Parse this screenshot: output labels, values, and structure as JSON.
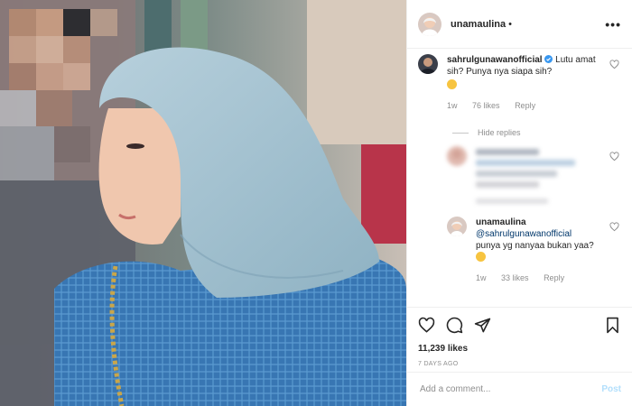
{
  "post": {
    "author": "unamaulina",
    "author_dot": "•",
    "more_label": "•••"
  },
  "comments": [
    {
      "author": "sahrulgunawanofficial",
      "verified": true,
      "text": "Lutu amat sih? Punya nya siapa sih?",
      "emoji": "heart-eyes-emoji",
      "time": "1w",
      "likes": "76 likes",
      "reply_label": "Reply"
    }
  ],
  "hide_replies_label": "Hide replies",
  "replies": [
    {
      "author": "unamaulina",
      "mention": "@sahrulgunawanofficial",
      "text": "punya yg nanyaa bukan yaa?",
      "emoji": "grin-emoji",
      "time": "1w",
      "likes": "33 likes",
      "reply_label": "Reply"
    }
  ],
  "actions": {
    "likes_count": "11,239 likes",
    "timestamp": "7 DAYS AGO"
  },
  "add_comment": {
    "placeholder": "Add a comment...",
    "post_label": "Post"
  },
  "colors": {
    "link": "#00376b",
    "verified": "#3897f0",
    "post_disabled": "#b2dffc",
    "hijab": "#9fbfd0",
    "dress": "#3d7bb8"
  }
}
